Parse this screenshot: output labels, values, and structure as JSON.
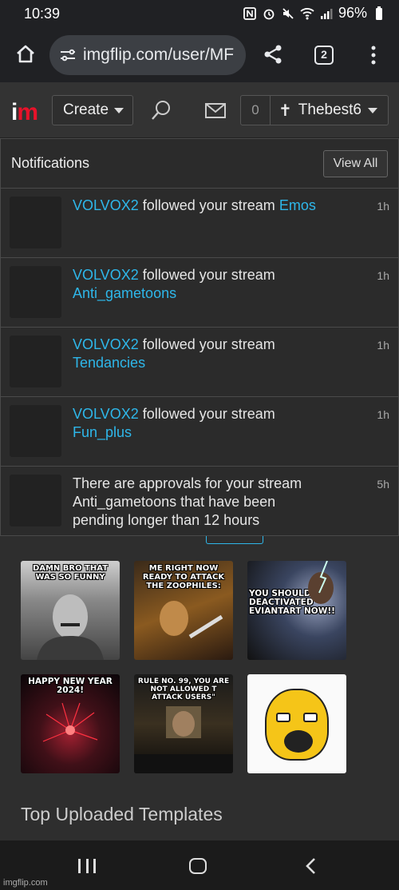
{
  "status_bar": {
    "time": "10:39",
    "battery": "96%"
  },
  "browser": {
    "url": "imgflip.com/user/MF",
    "tab_count": "2"
  },
  "nav": {
    "create_label": "Create",
    "notification_count": "0",
    "username": "Thebest6"
  },
  "notifications": {
    "title": "Notifications",
    "view_all_label": "View All",
    "items": [
      {
        "actor": "VOLVOX2",
        "action": "followed your stream",
        "stream": "Emos",
        "time": "1h"
      },
      {
        "actor": "VOLVOX2",
        "action": "followed your stream",
        "stream": "Anti_gametoons",
        "time": "1h"
      },
      {
        "actor": "VOLVOX2",
        "action": "followed your stream",
        "stream": "Tendancies",
        "time": "1h"
      },
      {
        "actor": "VOLVOX2",
        "action": "followed your stream",
        "stream": "Fun_plus",
        "time": "1h"
      },
      {
        "actor": "",
        "action": "There are approvals for your stream Anti_gametoons that have been pending longer than 12 hours",
        "stream": "",
        "time": "5h"
      }
    ]
  },
  "memes": [
    {
      "caption": "DAMN BRO THAT WAS SO FUNNY"
    },
    {
      "caption": "ME RIGHT NOW READY TO ATTACK THE ZOOPHILES:"
    },
    {
      "caption": "YOU SHOULD T DEACTIVATED EVIANTART NOW!!"
    },
    {
      "caption": "HAPPY NEW YEAR 2024!"
    },
    {
      "caption": "RULE NO. 99, YOU ARE NOT ALLOWED T ATTACK USERS\""
    },
    {
      "caption": ""
    }
  ],
  "section_title": "Top Uploaded Templates",
  "watermark": "imgflip.com"
}
